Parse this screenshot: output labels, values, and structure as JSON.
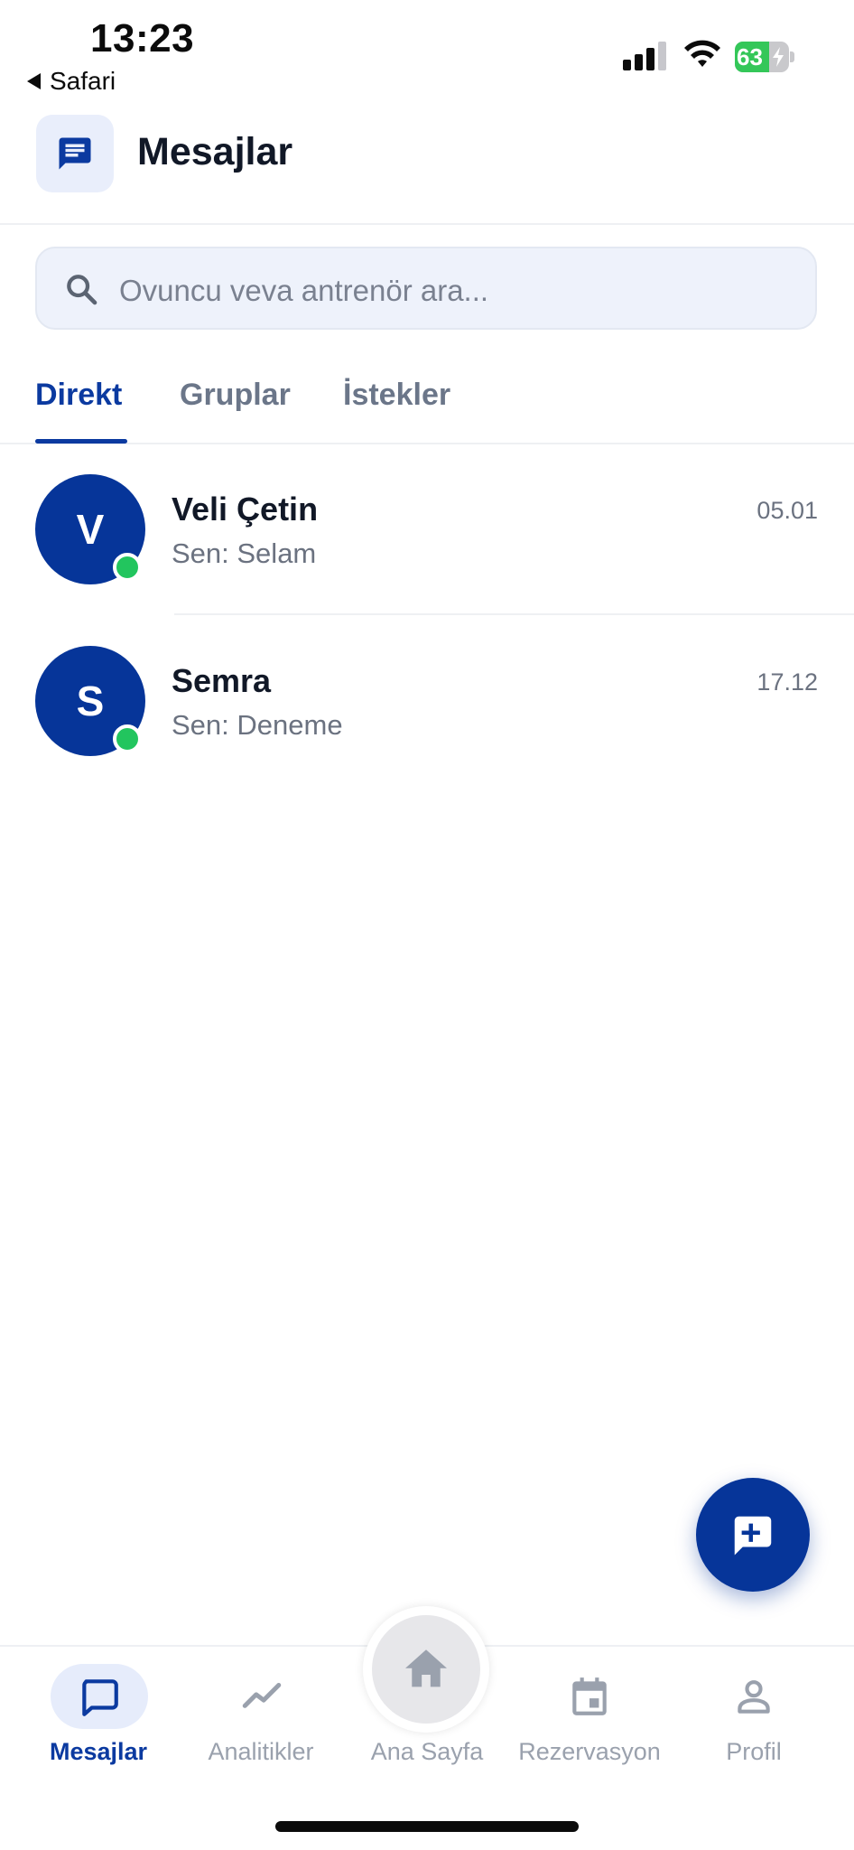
{
  "status_bar": {
    "time": "13:23",
    "back_app": "Safari",
    "battery_percent": 63,
    "battery_text": "63",
    "charging": true
  },
  "header": {
    "title": "Mesajlar",
    "icon": "chat-bubble-icon"
  },
  "search": {
    "placeholder": "Ovuncu veva antrenör ara..."
  },
  "tabs": [
    {
      "label": "Direkt",
      "active": true
    },
    {
      "label": "Gruplar",
      "active": false
    },
    {
      "label": "İstekler",
      "active": false
    }
  ],
  "conversations": [
    {
      "initial": "V",
      "name": "Veli Çetin",
      "preview": "Sen: Selam",
      "time": "05.01",
      "online": true
    },
    {
      "initial": "S",
      "name": "Semra",
      "preview": "Sen: Deneme",
      "time": "17.12",
      "online": true
    }
  ],
  "fab": {
    "icon": "add-chat-icon"
  },
  "bottom_nav": [
    {
      "label": "Mesajlar",
      "icon": "message-square-icon",
      "active": true
    },
    {
      "label": "Analitikler",
      "icon": "trending-icon",
      "active": false
    },
    {
      "label": "Ana Sayfa",
      "icon": "home-icon",
      "active": false
    },
    {
      "label": "Rezervasyon",
      "icon": "calendar-icon",
      "active": false
    },
    {
      "label": "Profil",
      "icon": "person-icon",
      "active": false
    }
  ],
  "colors": {
    "primary": "#063599",
    "active_tab": "#0b3aa0",
    "inactive_text": "#9aa1ad",
    "online": "#22c55e"
  }
}
